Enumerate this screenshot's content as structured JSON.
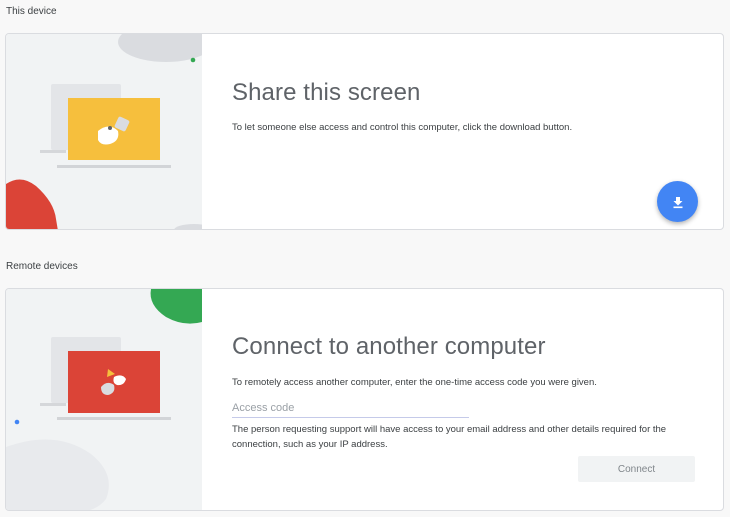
{
  "this_device": {
    "section_label": "This device",
    "title": "Share this screen",
    "description": "To let someone else access and control this computer, click the download button.",
    "download_icon": "download-icon",
    "accent_color": "#4285f4"
  },
  "remote_devices": {
    "section_label": "Remote devices",
    "title": "Connect to another computer",
    "description": "To remotely access another computer, enter the one-time access code you were given.",
    "input": {
      "value": "",
      "placeholder": "Access code"
    },
    "help_text": "The person requesting support will have access to your email address and other details required for the connection, such as your IP address.",
    "connect_label": "Connect"
  },
  "colors": {
    "yellow_laptop": "#f6bf3d",
    "red_laptop": "#db4437",
    "red_blob": "#db4437",
    "green_blob": "#34a853",
    "gray_blob": "#dadce0",
    "blue_dot": "#4285f4",
    "green_dot": "#34a853"
  }
}
